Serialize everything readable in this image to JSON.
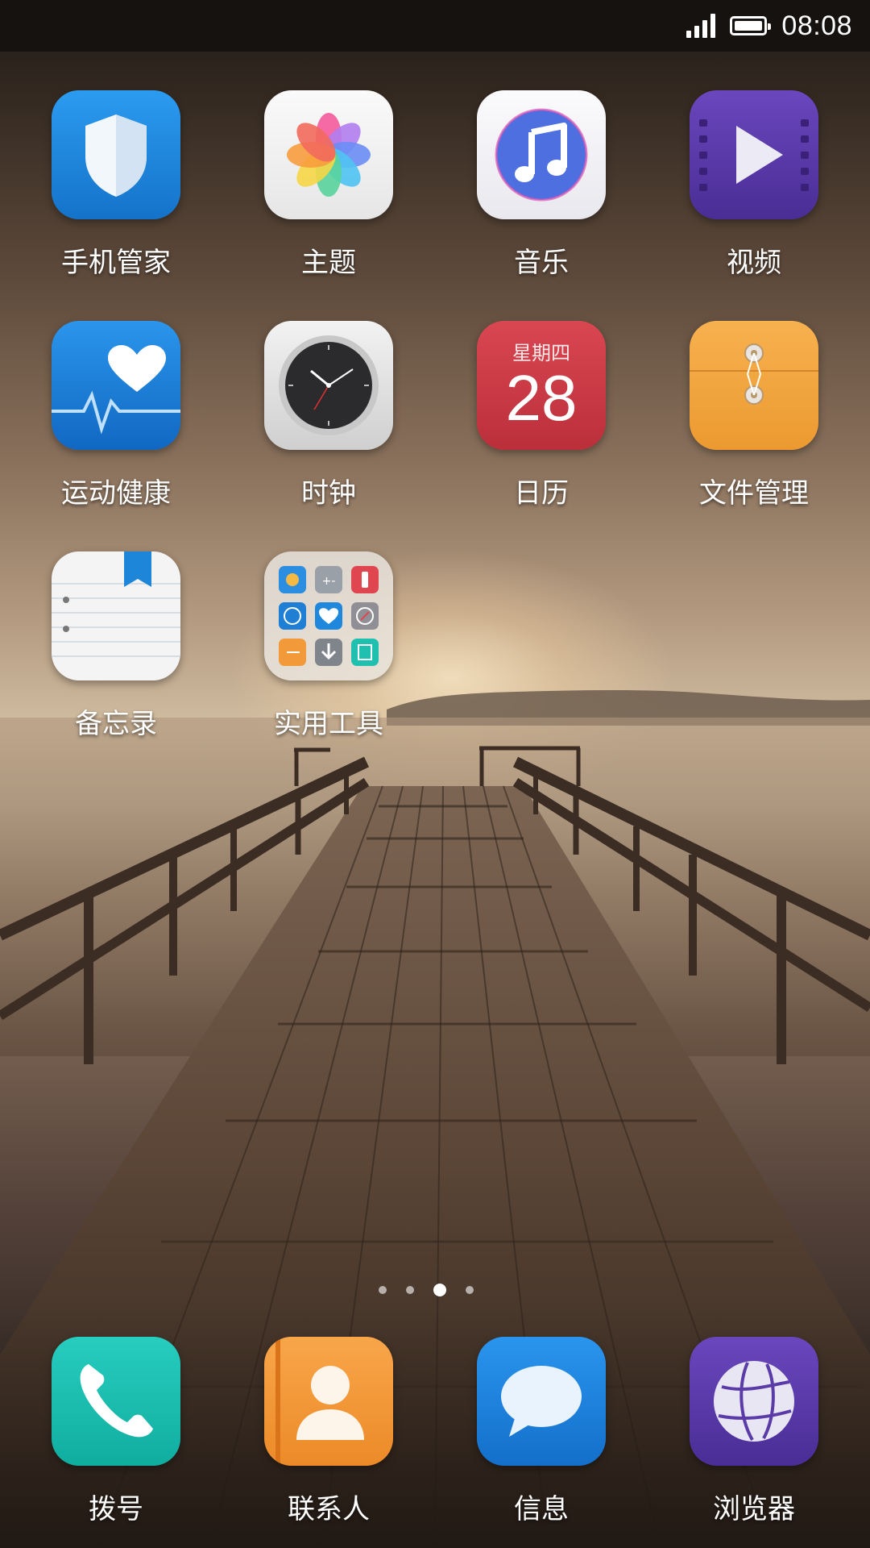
{
  "status_bar": {
    "time": "08:08",
    "signal_bars": 4,
    "battery_level": 1.0,
    "icons": [
      "signal-icon",
      "battery-icon"
    ]
  },
  "home": {
    "apps": [
      {
        "label": "手机管家",
        "icon": "shield-icon",
        "color": "#1c86d9"
      },
      {
        "label": "主题",
        "icon": "theme-petal-icon",
        "color": "#f2f2f2"
      },
      {
        "label": "音乐",
        "icon": "music-note-icon",
        "color": "#f1f1f5"
      },
      {
        "label": "视频",
        "icon": "play-icon",
        "color": "#5b3ba8"
      },
      {
        "label": "运动健康",
        "icon": "heart-icon",
        "color": "#1a7fd8"
      },
      {
        "label": "时钟",
        "icon": "clock-icon",
        "color": "#e3e3e3"
      },
      {
        "label": "日历",
        "icon": "calendar-icon",
        "color": "#cc3b47",
        "weekday": "星期四",
        "day": "28"
      },
      {
        "label": "文件管理",
        "icon": "folder-icon",
        "color": "#f2a53f"
      },
      {
        "label": "备忘录",
        "icon": "notepad-icon",
        "color": "#f4f4f4"
      },
      {
        "label": "实用工具",
        "icon": "tools-folder-icon",
        "color": "#e9e4dd"
      }
    ],
    "pages": {
      "count": 4,
      "current": 3
    }
  },
  "dock": {
    "apps": [
      {
        "label": "拨号",
        "icon": "phone-icon",
        "color": "#1cc0b4"
      },
      {
        "label": "联系人",
        "icon": "contact-icon",
        "color": "#f0963a"
      },
      {
        "label": "信息",
        "icon": "message-icon",
        "color": "#1a82dc"
      },
      {
        "label": "浏览器",
        "icon": "browser-globe-icon",
        "color": "#5b3ba8"
      }
    ]
  }
}
